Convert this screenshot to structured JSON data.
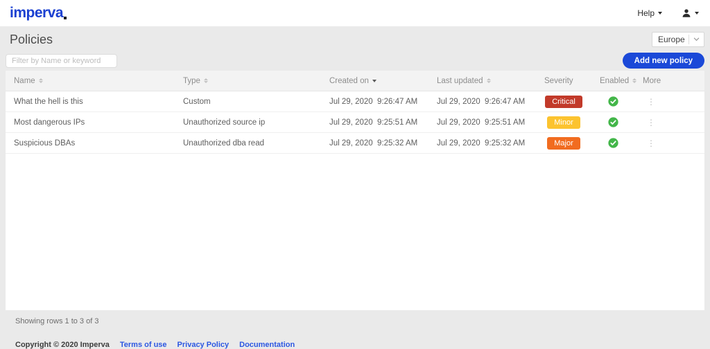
{
  "brand": {
    "logo_text": "imperva"
  },
  "top_nav": {
    "help_label": "Help"
  },
  "page": {
    "title": "Policies",
    "region_selected": "Europe",
    "filter_placeholder": "Filter by Name or keyword",
    "add_button_label": "Add new policy"
  },
  "colors": {
    "brand_blue": "#1b49d8",
    "critical": "#c23a2a",
    "minor": "#fcc32f",
    "major": "#f16c20",
    "enabled_green": "#43b649"
  },
  "table": {
    "columns": [
      {
        "label": "Name",
        "sort": "both"
      },
      {
        "label": "Type",
        "sort": "both"
      },
      {
        "label": "Created on",
        "sort": "desc"
      },
      {
        "label": "Last updated",
        "sort": "both"
      },
      {
        "label": "Severity",
        "sort": "none"
      },
      {
        "label": "Enabled",
        "sort": "both"
      },
      {
        "label": "More",
        "sort": "none"
      }
    ],
    "rows": [
      {
        "name": "What the hell is this",
        "type": "Custom",
        "created_on": "Jul 29, 2020  9:26:47 AM",
        "last_updated": "Jul 29, 2020  9:26:47 AM",
        "severity": "Critical",
        "severity_color": "#c23a2a",
        "enabled": true
      },
      {
        "name": "Most dangerous IPs",
        "type": "Unauthorized source ip",
        "created_on": "Jul 29, 2020  9:25:51 AM",
        "last_updated": "Jul 29, 2020  9:25:51 AM",
        "severity": "Minor",
        "severity_color": "#fcc32f",
        "enabled": true
      },
      {
        "name": "Suspicious DBAs",
        "type": "Unauthorized dba read",
        "created_on": "Jul 29, 2020  9:25:32 AM",
        "last_updated": "Jul 29, 2020  9:25:32 AM",
        "severity": "Major",
        "severity_color": "#f16c20",
        "enabled": true
      }
    ],
    "summary": "Showing rows 1 to 3 of 3"
  },
  "footer": {
    "copyright": "Copyright © 2020 Imperva",
    "links": [
      "Terms of use",
      "Privacy Policy",
      "Documentation"
    ]
  }
}
